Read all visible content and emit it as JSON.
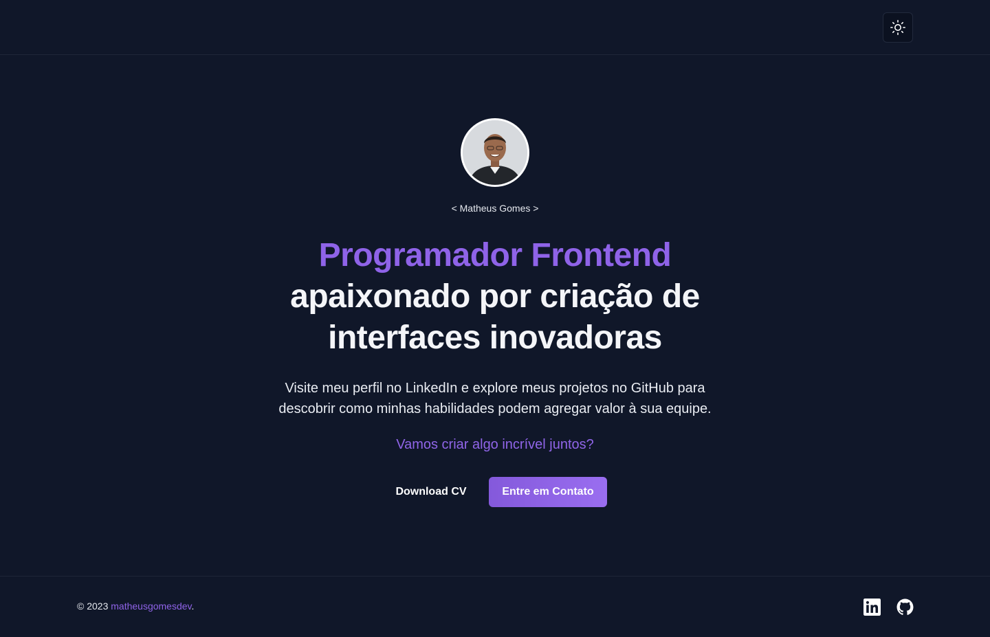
{
  "header": {
    "theme_toggle_icon": "sun-icon"
  },
  "hero": {
    "avatar_icon": "profile-photo",
    "handle": "< Matheus Gomes >",
    "headline_accent": "Programador Frontend",
    "headline_rest": "apaixonado por criação de interfaces inovadoras",
    "description": "Visite meu perfil no LinkedIn e explore meus projetos no GitHub para descobrir como minhas habilidades podem agregar valor à sua equipe.",
    "cta_text": "Vamos criar algo incrível juntos?",
    "download_label": "Download CV",
    "contact_label": "Entre em Contato"
  },
  "footer": {
    "copyright_prefix": "© 2023 ",
    "brand": "matheusgomesdev",
    "copyright_suffix": ".",
    "social_icons": [
      "linkedin-icon",
      "github-icon"
    ]
  },
  "colors": {
    "background": "#101729",
    "accent": "#8f63e8",
    "text": "#f1f3f7",
    "border": "#1f2638"
  }
}
